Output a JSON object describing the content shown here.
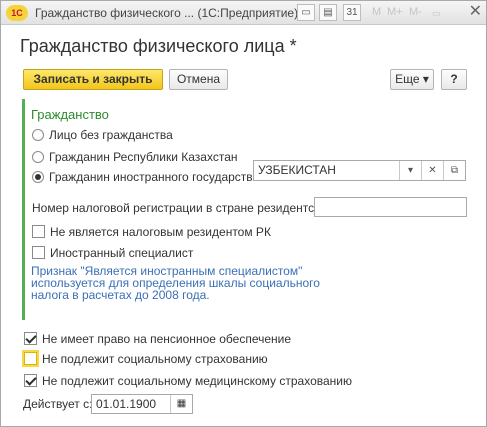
{
  "window": {
    "title": "Гражданство физического ... (1С:Предприятие)",
    "app_badge": "1С",
    "toolbar_m": "M",
    "toolbar_mplus": "M+",
    "toolbar_mminus": "M-",
    "calendar_day": "31"
  },
  "page": {
    "title": "Гражданство физического лица *"
  },
  "toolbar": {
    "save_close": "Записать и закрыть",
    "cancel": "Отмена",
    "more": "Еще ▾",
    "help": "?"
  },
  "citizenship": {
    "group_title": "Гражданство",
    "options": [
      {
        "label": "Лицо без гражданства",
        "selected": false
      },
      {
        "label": "Гражданин Республики Казахстан",
        "selected": false
      },
      {
        "label": "Гражданин иностранного государства",
        "selected": true
      }
    ],
    "country_value": "УЗБЕКИСТАН"
  },
  "tax": {
    "reg_number_label": "Номер налоговой регистрации в стране резидентства:",
    "reg_number_value": "",
    "non_resident_label": "Не является налоговым резидентом РК",
    "foreign_specialist_label": "Иностранный специалист",
    "hint": "Признак \"Является иностранным специалистом\" используется для определения шкалы социального налога в расчетах до 2008 года."
  },
  "flags": {
    "no_pension": {
      "label": "Не имеет право на пенсионное обеспечение",
      "checked": true
    },
    "no_social": {
      "label": "Не подлежит социальному страхованию",
      "checked": false
    },
    "no_medical": {
      "label": "Не подлежит социальному медицинскому страхованию",
      "checked": true
    }
  },
  "effective": {
    "label": "Действует с:",
    "date": "01.01.1900"
  },
  "colors": {
    "accent": "#f3c51a",
    "group": "#2e8b2e",
    "hint": "#3a6fb5"
  }
}
